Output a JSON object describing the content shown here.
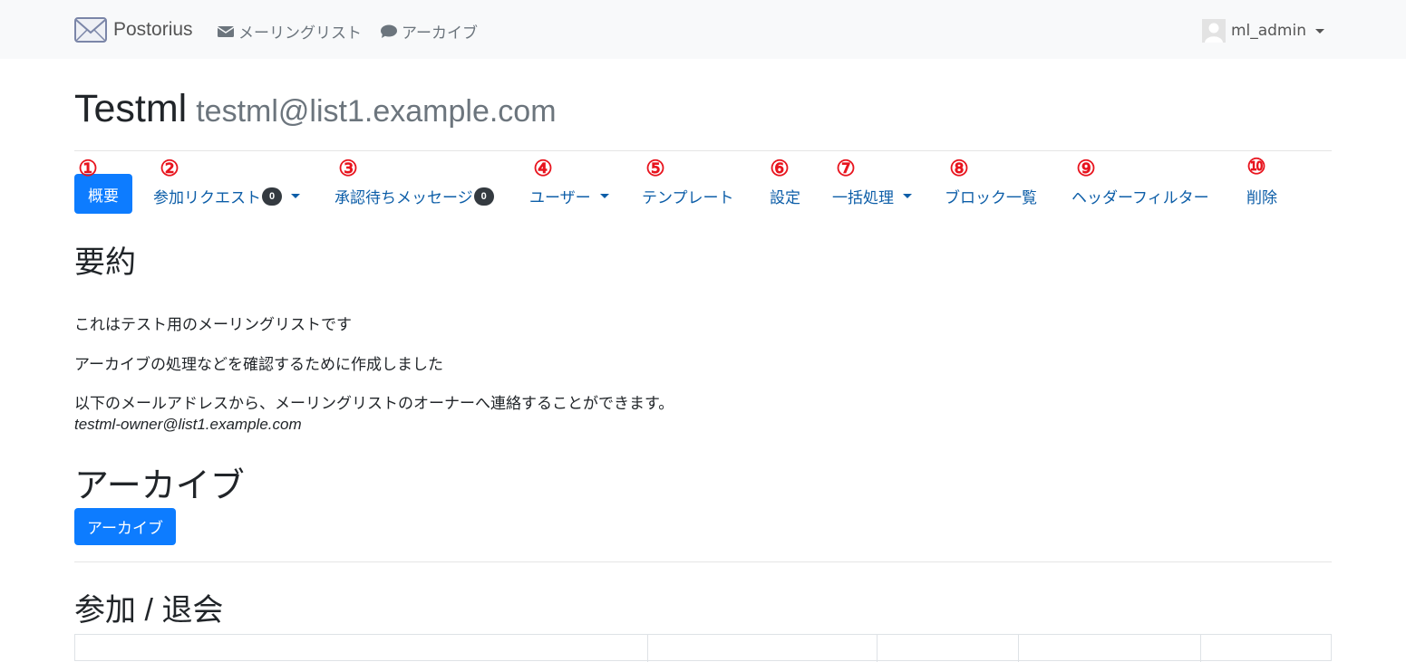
{
  "navbar": {
    "brand": "Postorius",
    "mailing_lists": "メーリングリスト",
    "archives": "アーカイブ",
    "user": "ml_admin"
  },
  "header": {
    "list_name": "Testml",
    "list_address": "testml@list1.example.com"
  },
  "tabs": [
    {
      "label": "概要",
      "marker": "①"
    },
    {
      "label": "参加リクエスト",
      "badge": "0",
      "marker": "②"
    },
    {
      "label": "承認待ちメッセージ",
      "badge": "0",
      "marker": "③"
    },
    {
      "label": "ユーザー",
      "marker": "④"
    },
    {
      "label": "テンプレート",
      "marker": "⑤"
    },
    {
      "label": "設定",
      "marker": "⑥"
    },
    {
      "label": "一括処理",
      "marker": "⑦"
    },
    {
      "label": "ブロック一覧",
      "marker": "⑧"
    },
    {
      "label": "ヘッダーフィルター",
      "marker": "⑨"
    },
    {
      "label": "削除",
      "marker": "⑩"
    }
  ],
  "summary": {
    "heading": "要約",
    "lines": [
      "これはテスト用のメーリングリストです",
      "アーカイブの処理などを確認するために作成しました",
      "以下のメールアドレスから、メーリングリストのオーナーへ連絡することができます。"
    ],
    "owner_email": "testml-owner@list1.example.com"
  },
  "archive": {
    "heading": "アーカイブ",
    "button": "アーカイブ"
  },
  "subscribe": {
    "heading": "参加 / 退会"
  },
  "colors": {
    "primary": "#0d7cff",
    "link": "#0d5ea8",
    "marker": "#e8141e"
  }
}
